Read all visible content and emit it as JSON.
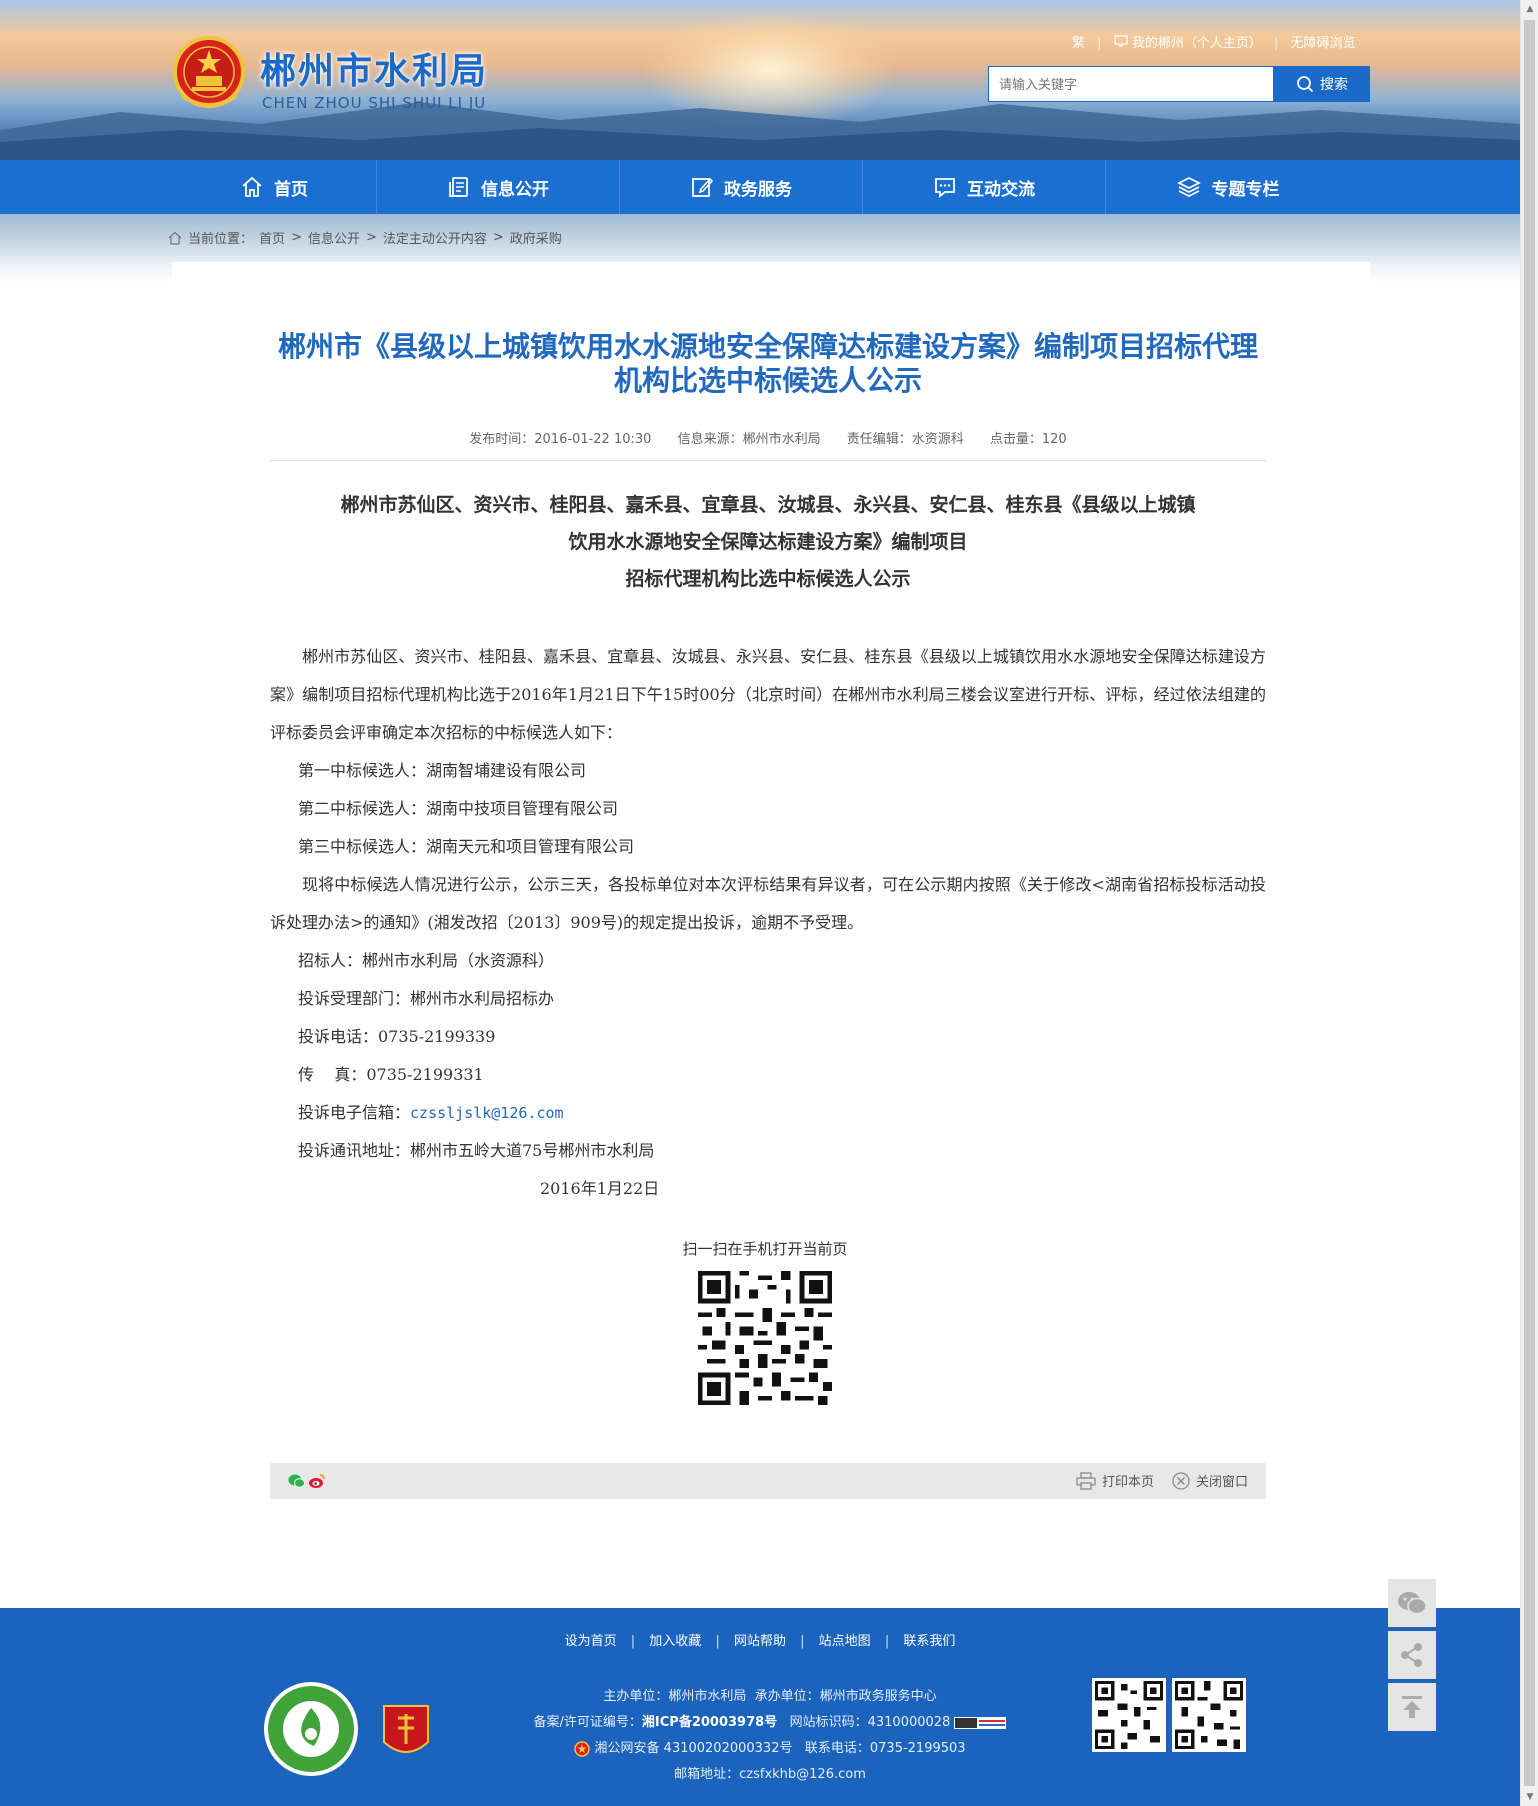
{
  "header": {
    "site_name": "郴州市水利局",
    "site_name_en": "CHEN ZHOU SHI SHUI LI JU",
    "toplinks": {
      "traditional": "繁",
      "my_chenzhou": "我的郴州（个人主页）",
      "accessible": "无障碍浏览"
    },
    "search": {
      "placeholder": "请输入关键字",
      "button_label": "搜索"
    }
  },
  "nav": {
    "items": [
      {
        "label": "首页",
        "icon": "home-icon"
      },
      {
        "label": "信息公开",
        "icon": "document-icon"
      },
      {
        "label": "政务服务",
        "icon": "edit-icon"
      },
      {
        "label": "互动交流",
        "icon": "chat-icon"
      },
      {
        "label": "专题专栏",
        "icon": "layers-icon"
      }
    ]
  },
  "breadcrumb": {
    "prefix": "当前位置：",
    "items": [
      "首页",
      "信息公开",
      "法定主动公开内容",
      "政府采购"
    ],
    "separator": ">"
  },
  "article": {
    "title": "郴州市《县级以上城镇饮用水水源地安全保障达标建设方案》编制项目招标代理机构比选中标候选人公示",
    "meta": {
      "published": "发布时间：2016-01-22 10:30",
      "source": "信息来源：郴州市水利局",
      "editor": "责任编辑：水资源科",
      "views": "点击量：120"
    },
    "subtitle_lines": [
      "郴州市苏仙区、资兴市、桂阳县、嘉禾县、宜章县、汝城县、永兴县、安仁县、桂东县《县级以上城镇",
      "饮用水水源地安全保障达标建设方案》编制项目",
      "招标代理机构比选中标候选人公示"
    ],
    "intro": "郴州市苏仙区、资兴市、桂阳县、嘉禾县、宜章县、汝城县、永兴县、安仁县、桂东县《县级以上城镇饮用水水源地安全保障达标建设方案》编制项目招标代理机构比选于2016年1月21日下午15时00分（北京时间）在郴州市水利局三楼会议室进行开标、评标，经过依法组建的评标委员会评审确定本次招标的中标候选人如下：",
    "candidates": [
      "第一中标候选人：湖南智埔建设有限公司",
      "第二中标候选人：湖南中技项目管理有限公司",
      "第三中标候选人：湖南天元和项目管理有限公司"
    ],
    "notice": "现将中标候选人情况进行公示，公示三天，各投标单位对本次评标结果有异议者，可在公示期内按照《关于修改<湖南省招标投标活动投诉处理办法>的通知》(湘发改招〔2013〕909号)的规定提出投诉，逾期不予受理。",
    "contacts": {
      "tenderer": "招标人：郴州市水利局（水资源科）",
      "dept": "投诉受理部门：郴州市水利局招标办",
      "phone": "投诉电话：0735-2199339",
      "fax": "传    真：0735-2199331",
      "email_label": "投诉电子信箱：",
      "email": "czssljslk@126.com",
      "address": "投诉通讯地址：郴州市五岭大道75号郴州市水利局"
    },
    "date": "2016年1月22日",
    "qr_caption": "扫一扫在手机打开当前页"
  },
  "share_bar": {
    "print_label": "打印本页",
    "close_label": "关闭窗口"
  },
  "footer": {
    "links": [
      "设为首页",
      "加入收藏",
      "网站帮助",
      "站点地图",
      "联系我们"
    ],
    "host": "主办单位：郴州市水利局",
    "organizer": "承办单位：郴州市政务服务中心",
    "icp_label": "备案/许可证编号：",
    "icp": "湘ICP备20003978号",
    "site_code": "网站标识码：4310000028",
    "police": "湘公网安备 43100202000332号",
    "phone": "联系电话：0735-2199503",
    "email": "邮箱地址：czsfxkhb@126.com"
  },
  "colors": {
    "brand_blue": "#1b6fd0",
    "title_blue": "#2169be",
    "footer_blue": "#1b63bd"
  }
}
